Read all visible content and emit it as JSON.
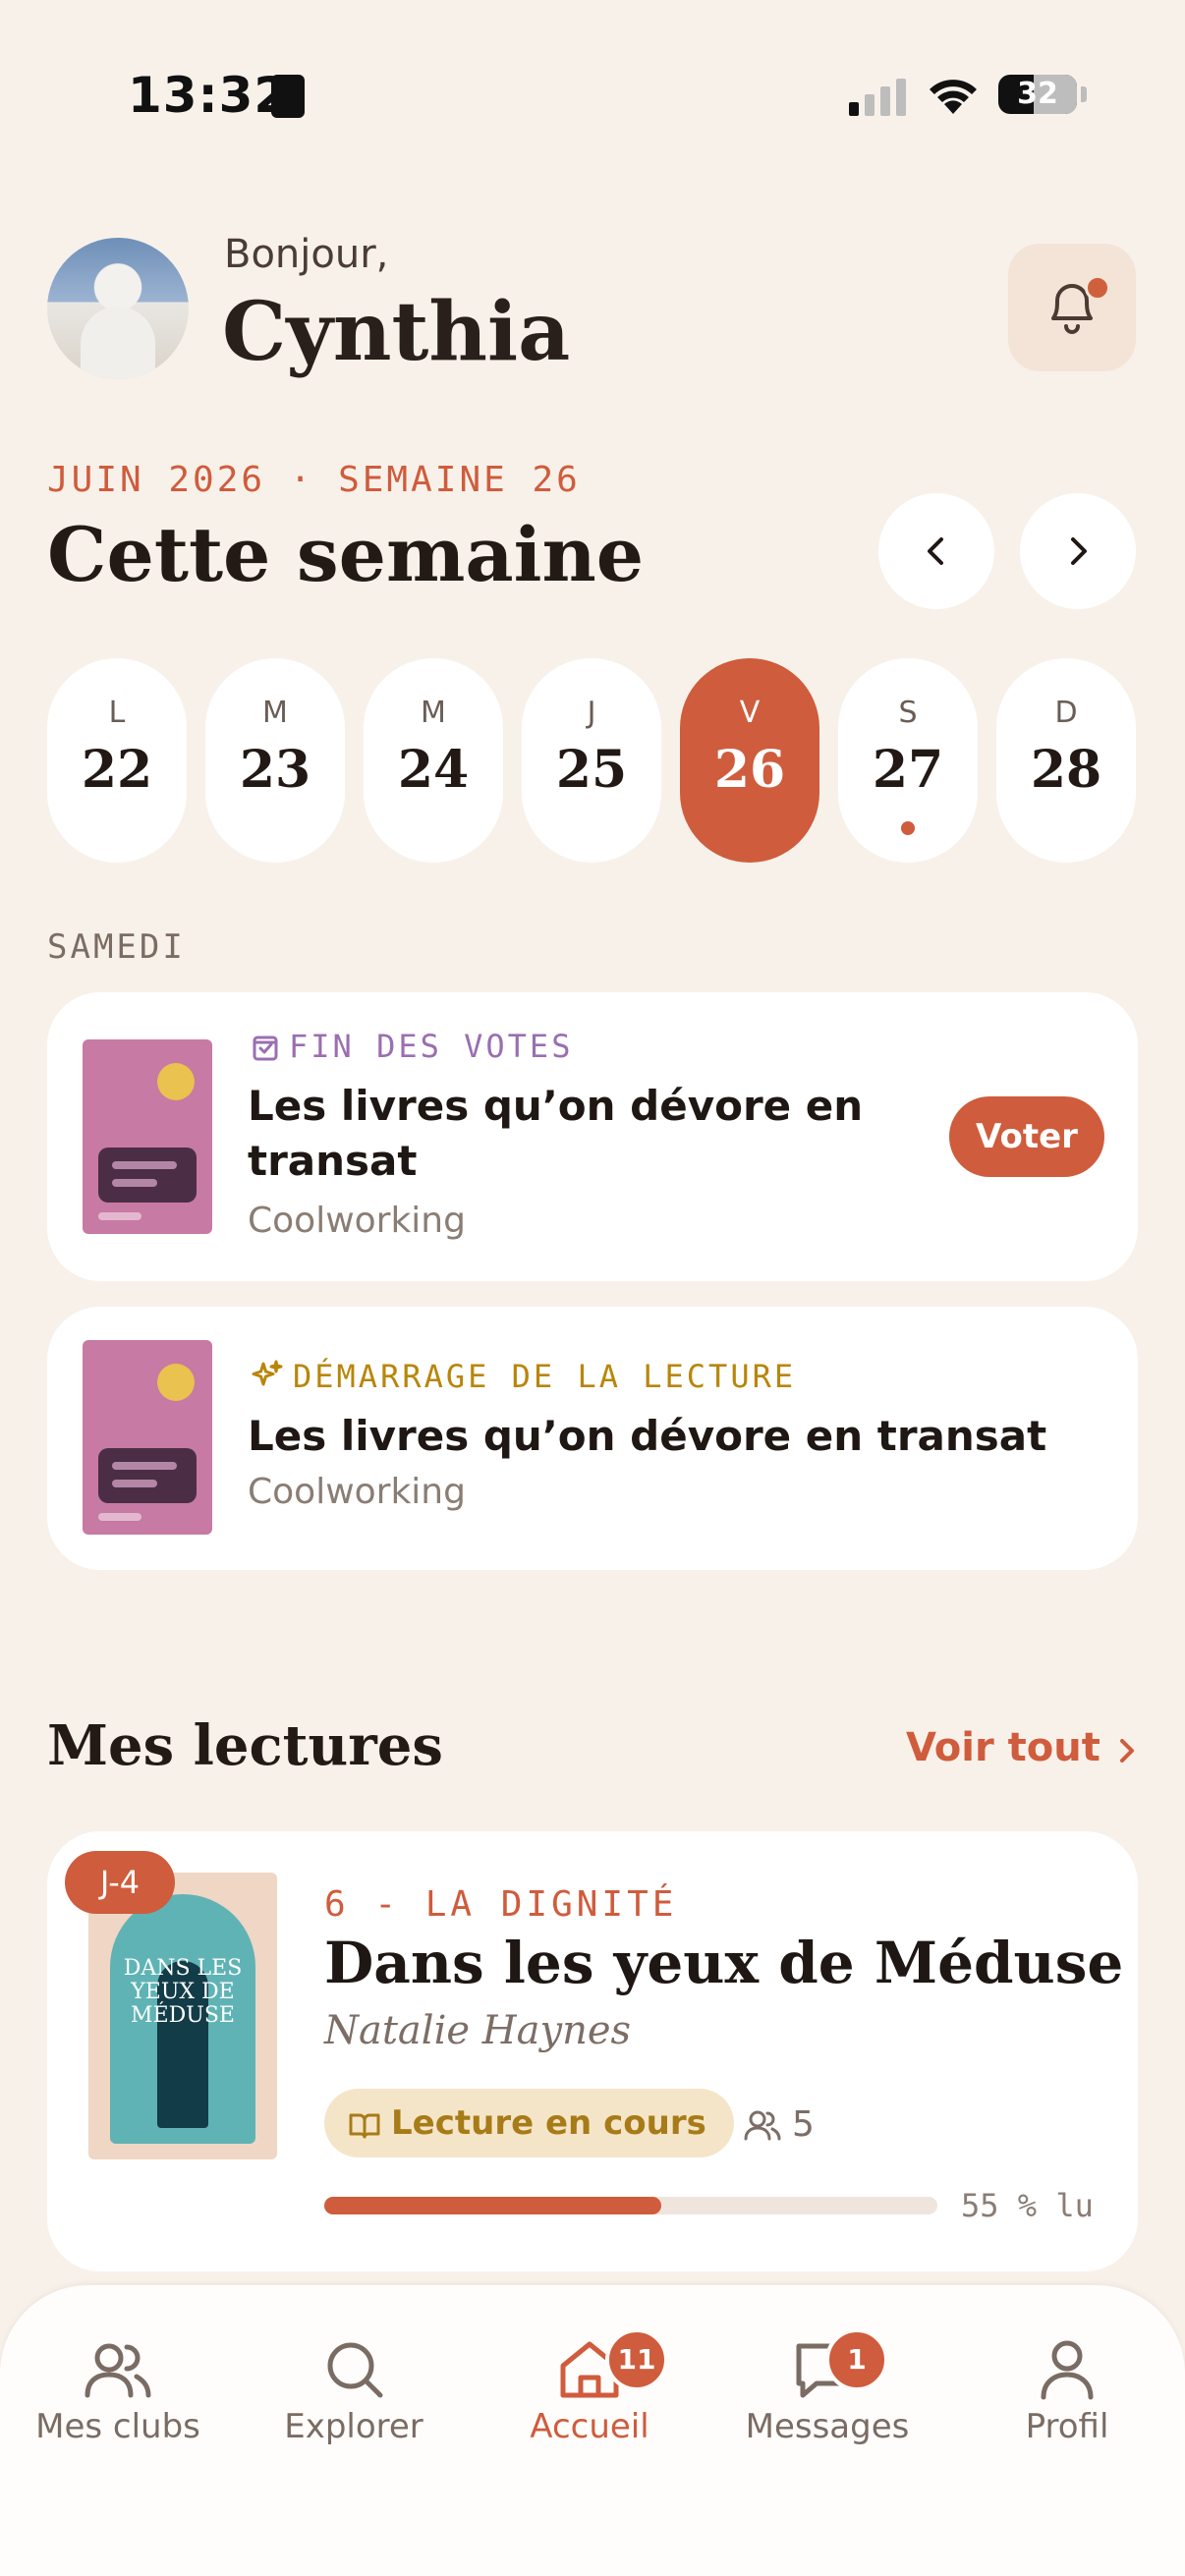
{
  "status_bar": {
    "time": "13:32",
    "battery": "32"
  },
  "header": {
    "greeting": "Bonjour,",
    "user_name": "Cynthia",
    "notification_icon": "bell-icon"
  },
  "week": {
    "label": "JUIN 2026 · SEMAINE 26",
    "title": "Cette semaine",
    "days": [
      {
        "letter": "L",
        "number": "22",
        "active": false,
        "has_event": false
      },
      {
        "letter": "M",
        "number": "23",
        "active": false,
        "has_event": false
      },
      {
        "letter": "M",
        "number": "24",
        "active": false,
        "has_event": false
      },
      {
        "letter": "J",
        "number": "25",
        "active": false,
        "has_event": false
      },
      {
        "letter": "V",
        "number": "26",
        "active": true,
        "has_event": false
      },
      {
        "letter": "S",
        "number": "27",
        "active": false,
        "has_event": true
      },
      {
        "letter": "D",
        "number": "28",
        "active": false,
        "has_event": false
      }
    ]
  },
  "schedule": {
    "day_label": "SAMEDI",
    "events": [
      {
        "tag": "FIN DES VOTES",
        "tag_icon": "vote-check-icon",
        "tag_color": "#9a6fb0",
        "title_line1": "Les livres qu’on dévore en",
        "title_line2": "transat",
        "club": "Coolworking",
        "action_label": "Voter"
      },
      {
        "tag": "DÉMARRAGE DE LA LECTURE",
        "tag_icon": "sparkles-icon",
        "tag_color": "#b8860b",
        "title_line1": "Les livres qu’on dévore en transat",
        "club": "Coolworking"
      }
    ]
  },
  "readings": {
    "title": "Mes lectures",
    "see_all_label": "Voir tout",
    "books": [
      {
        "countdown_badge": "J-4",
        "chapter": "6 - LA DIGNITÉ",
        "title": "Dans les yeux de Méduse",
        "author": "Natalie Haynes",
        "status_label": "Lecture en cours",
        "members_count": "5",
        "progress_fraction": 0.55,
        "progress_label": "55 % lu",
        "cover_text": "DANS LES YEUX DE MÉDUSE"
      }
    ]
  },
  "tabbar": {
    "tabs": [
      {
        "label": "Mes clubs",
        "icon": "users-icon",
        "active": false,
        "badge": ""
      },
      {
        "label": "Explorer",
        "icon": "search-icon",
        "active": false,
        "badge": ""
      },
      {
        "label": "Accueil",
        "icon": "home-icon",
        "active": true,
        "badge": "11"
      },
      {
        "label": "Messages",
        "icon": "message-icon",
        "active": false,
        "badge": "1"
      },
      {
        "label": "Profil",
        "icon": "user-icon",
        "active": false,
        "badge": ""
      }
    ]
  },
  "colors": {
    "background": "#f8f1ea",
    "accent": "#cf5c3c",
    "card": "#ffffff"
  }
}
